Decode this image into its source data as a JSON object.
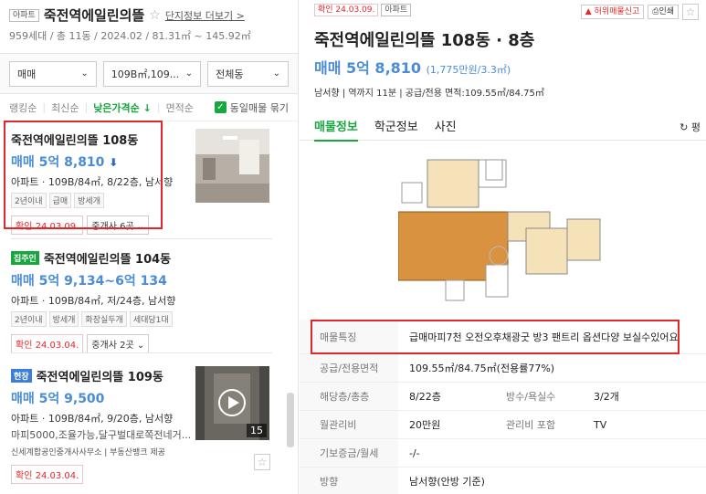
{
  "complex": {
    "type_tag": "아파트",
    "name": "죽전역에일린의뜰",
    "star": "☆",
    "more_link": "단지정보 더보기 >",
    "summary": "959세대 / 총 11동 / 2024.02 / 81.31㎡ ~ 145.92㎡"
  },
  "filters": {
    "trade": "매매",
    "area": "109B㎡,109...",
    "building": "전체동"
  },
  "sort": {
    "items": [
      "랭킹순",
      "최신순",
      "낮은가격순 ↓",
      "면적순"
    ],
    "active_index": 2,
    "same_listing_label": "동일매물 묶기"
  },
  "listings": [
    {
      "title": "죽전역에일린의뜰 108동",
      "price": "매매 5억 8,810",
      "price_arrow": "down",
      "info": "아파트 · 109B/84㎡, 8/22층, 남서향",
      "tags": [
        "2년이내",
        "급매",
        "방세개"
      ],
      "confirm": "확인 24.03.09.",
      "agents": "중개사 6곳"
    },
    {
      "badge": "집주인",
      "badge_color": "#18a63f",
      "title": "죽전역에일린의뜰 104동",
      "price": "매매 5억 9,134~6억 134",
      "info": "아파트 · 109B/84㎡, 저/24층, 남서향",
      "tags": [
        "2년이내",
        "방세개",
        "화장실두개",
        "세대당1대"
      ],
      "confirm": "확인 24.03.04.",
      "agents": "중개사 2곳"
    },
    {
      "badge": "현장",
      "badge_color": "#3d7fd8",
      "title": "죽전역에일린의뜰 109동",
      "price": "매매 5억 9,500",
      "info": "아파트 · 109B/84㎡, 9/20층, 남서향",
      "desc": "마피5000,조율가능,달구벌대로쪽전네거...",
      "source": "신세계합공인중개사사무소 | 부동산뱅크 제공",
      "confirm": "확인 24.03.04.",
      "photo_count": "15"
    }
  ],
  "detail": {
    "confirm": "확인 24.03.09.",
    "type_tag": "아파트",
    "report_btn": "허위매물신고",
    "print_btn": "인쇄",
    "title": "죽전역에일린의뜰 108동 · 8층",
    "price": "매매 5억 8,810",
    "price_unit": "(1,775만원/3.3㎡)",
    "info": "남서향 | 역까지 11분 | 공급/전용 면적:109.55㎡/84.75㎡",
    "tabs": [
      "매물정보",
      "학군정보",
      "사진"
    ],
    "refresh": "평",
    "feature_label": "매물특징",
    "feature_value": "급매마피7천 오전오후채광굿 방3 팬트리 옵션다양 보실수있어요",
    "rows": [
      {
        "k": "공급/전용면적",
        "v": "109.55㎡/84.75㎡(전용률77%)"
      },
      {
        "k": "해당층/총층",
        "v": "8/22층",
        "k2": "방수/욕실수",
        "v2": "3/2개"
      },
      {
        "k": "월관리비",
        "v": "20만원",
        "k2": "관리비 포함",
        "v2": "TV"
      },
      {
        "k": "기보증금/월세",
        "v": "-/-"
      },
      {
        "k": "방향",
        "v": "남서향(안방 기준)"
      }
    ]
  },
  "colors": {
    "accent": "#18a63f",
    "price": "#4a8cd8",
    "red": "#e2262a"
  }
}
